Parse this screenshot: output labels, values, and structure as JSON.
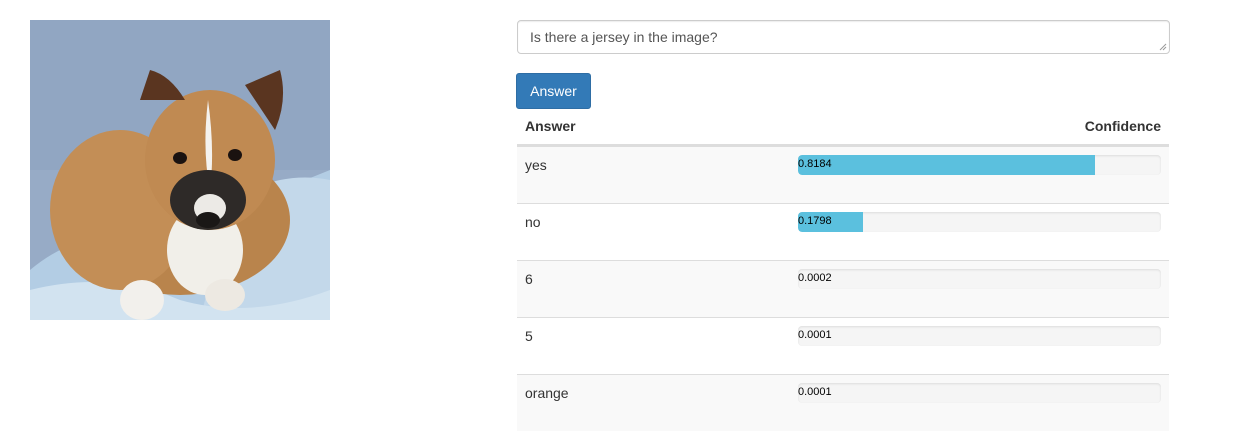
{
  "question": {
    "value": "Is there a jersey in the image?"
  },
  "answer_button": {
    "label": "Answer"
  },
  "table": {
    "headers": {
      "answer": "Answer",
      "confidence": "Confidence"
    },
    "rows": [
      {
        "answer": "yes",
        "confidence": 0.8184,
        "confidence_text": "0.8184"
      },
      {
        "answer": "no",
        "confidence": 0.1798,
        "confidence_text": "0.1798"
      },
      {
        "answer": "6",
        "confidence": 0.0002,
        "confidence_text": "0.0002"
      },
      {
        "answer": "5",
        "confidence": 0.0001,
        "confidence_text": "0.0001"
      },
      {
        "answer": "orange",
        "confidence": 0.0001,
        "confidence_text": "0.0001"
      }
    ]
  },
  "colors": {
    "button": "#337ab7",
    "bar_fill": "#5bc0de",
    "bar_track": "#f5f5f5"
  }
}
